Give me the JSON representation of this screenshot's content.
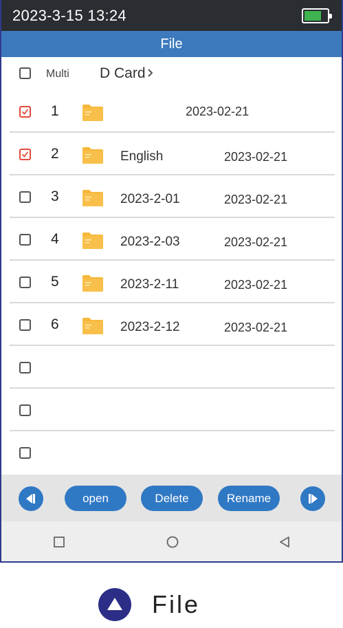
{
  "status": {
    "time": "2023-3-15 13:24",
    "battery_icon": "battery-icon",
    "battery_color": "#3fb34f"
  },
  "title": "File",
  "header": {
    "multi_label": "Multi",
    "breadcrumb": "D Card",
    "breadcrumb_chevron": "chevron-right-icon"
  },
  "rows": [
    {
      "checked": true,
      "num": "1",
      "icon": "folder-icon",
      "name": "",
      "date": "2023-02-21"
    },
    {
      "checked": true,
      "num": "2",
      "icon": "folder-icon",
      "name": "English",
      "date": "2023-02-21"
    },
    {
      "checked": false,
      "num": "3",
      "icon": "folder-icon",
      "name": "2023-2-01",
      "date": "2023-02-21"
    },
    {
      "checked": false,
      "num": "4",
      "icon": "folder-icon",
      "name": "2023-2-03",
      "date": "2023-02-21"
    },
    {
      "checked": false,
      "num": "5",
      "icon": "folder-icon",
      "name": "2023-2-11",
      "date": "2023-02-21"
    },
    {
      "checked": false,
      "num": "6",
      "icon": "folder-icon",
      "name": "2023-2-12",
      "date": "2023-02-21"
    },
    {
      "checked": false,
      "num": "",
      "name": "",
      "date": ""
    },
    {
      "checked": false,
      "num": "",
      "name": "",
      "date": ""
    },
    {
      "checked": false,
      "num": "",
      "name": "",
      "date": ""
    }
  ],
  "toolbar": {
    "prev_icon": "previous-page-icon",
    "open_label": "open",
    "delete_label": "Delete",
    "rename_label": "Rename",
    "next_icon": "next-page-icon"
  },
  "system_nav": {
    "recents_icon": "square-icon",
    "home_icon": "circle-icon",
    "back_icon": "triangle-back-icon"
  },
  "caption": {
    "icon": "triangle-up-icon",
    "text": "File"
  },
  "colors": {
    "status_bar": "#2a2d31",
    "title_bar": "#3d7abd",
    "accent_blue": "#2f78c4",
    "checked_red": "#e24a3b",
    "folder_yellow": "#f6b83b",
    "caption_circle": "#2b2d86"
  }
}
